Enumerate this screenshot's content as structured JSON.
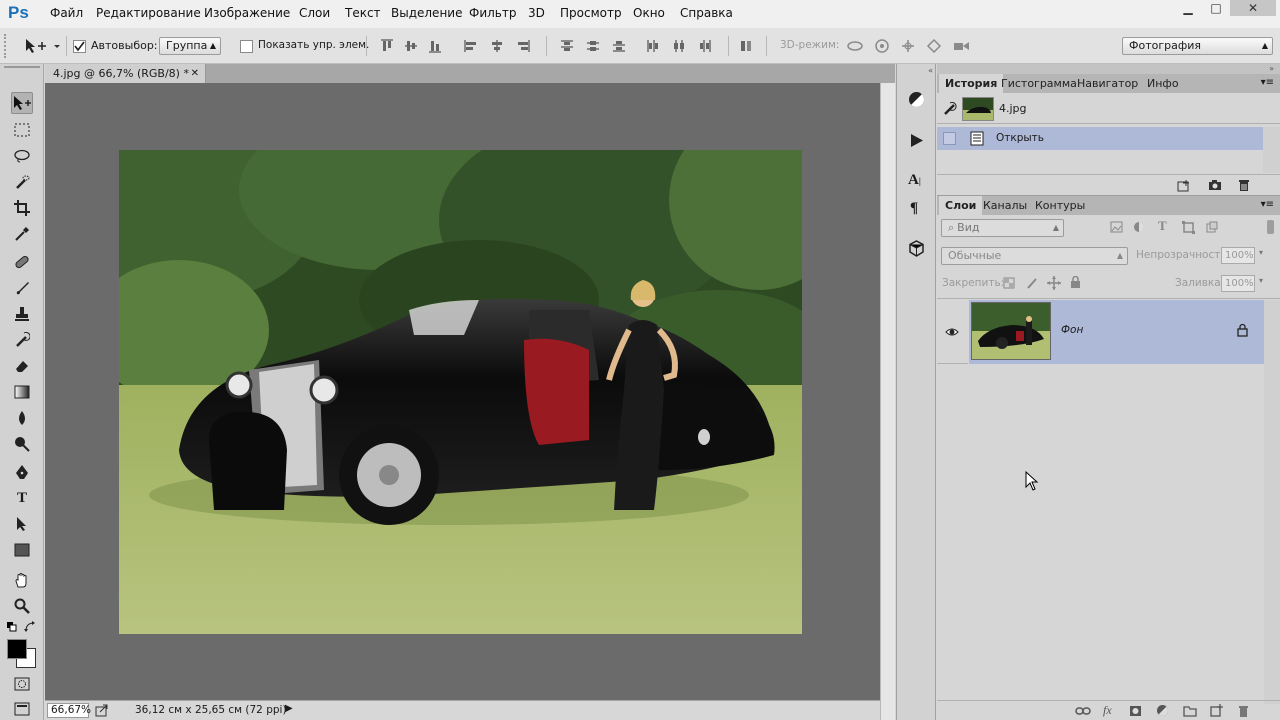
{
  "app": {
    "logo": "Ps"
  },
  "menu": [
    "Файл",
    "Редактирование",
    "Изображение",
    "Слои",
    "Текст",
    "Выделение",
    "Фильтр",
    "3D",
    "Просмотр",
    "Окно",
    "Справка"
  ],
  "window_controls": {
    "minimize": "▁",
    "maximize": "□",
    "close": "✕"
  },
  "options": {
    "autoselect_label": "Автовыбор:",
    "autoselect_checked": true,
    "autoselect_target": "Группа",
    "show_transform_label": "Показать упр. элем.",
    "mode3d_label": "3D-режим:",
    "workspace": "Фотография"
  },
  "document": {
    "tab_title": "4.jpg @ 66,7% (RGB/8) *",
    "zoom": "66,67%",
    "doc_size": "36,12 см x 25,65 см (72 ppi)"
  },
  "history_panel": {
    "tabs": [
      "История",
      "Гистограмма",
      "Навигатор",
      "Инфо"
    ],
    "active_tab": "История",
    "snapshot": "4.jpg",
    "steps": [
      "Открыть"
    ]
  },
  "layers_panel": {
    "tabs": [
      "Слои",
      "Каналы",
      "Контуры"
    ],
    "active_tab": "Слои",
    "filter_kind": "Вид",
    "blend_mode": "Обычные",
    "opacity_label": "Непрозрачность:",
    "opacity": "100%",
    "lock_label": "Закрепить:",
    "fill_label": "Заливка:",
    "fill": "100%",
    "layers": [
      {
        "name": "Фон",
        "visible": true,
        "locked": true
      }
    ]
  },
  "colors": {
    "foreground": "#000000",
    "background": "#ffffff",
    "selection": "#aeb9d8"
  }
}
